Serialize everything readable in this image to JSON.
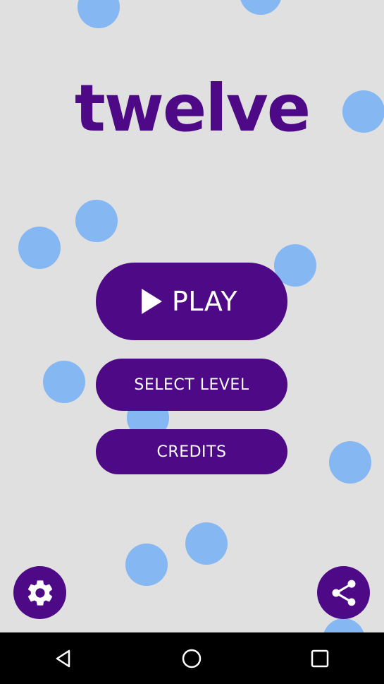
{
  "game": {
    "title": "twelve",
    "accent_color": "#4e0a86",
    "background_color": "#e0e0e0",
    "bubble_color": "#85b7f2"
  },
  "menu": {
    "play_label": "PLAY",
    "play_icon": "play-icon",
    "select_level_label": "SELECT LEVEL",
    "credits_label": "CREDITS"
  },
  "footer": {
    "settings_icon": "gear-icon",
    "share_icon": "share-icon"
  },
  "navigation_bar": {
    "back_icon": "back-triangle-icon",
    "home_icon": "home-circle-icon",
    "recents_icon": "recents-square-icon"
  }
}
